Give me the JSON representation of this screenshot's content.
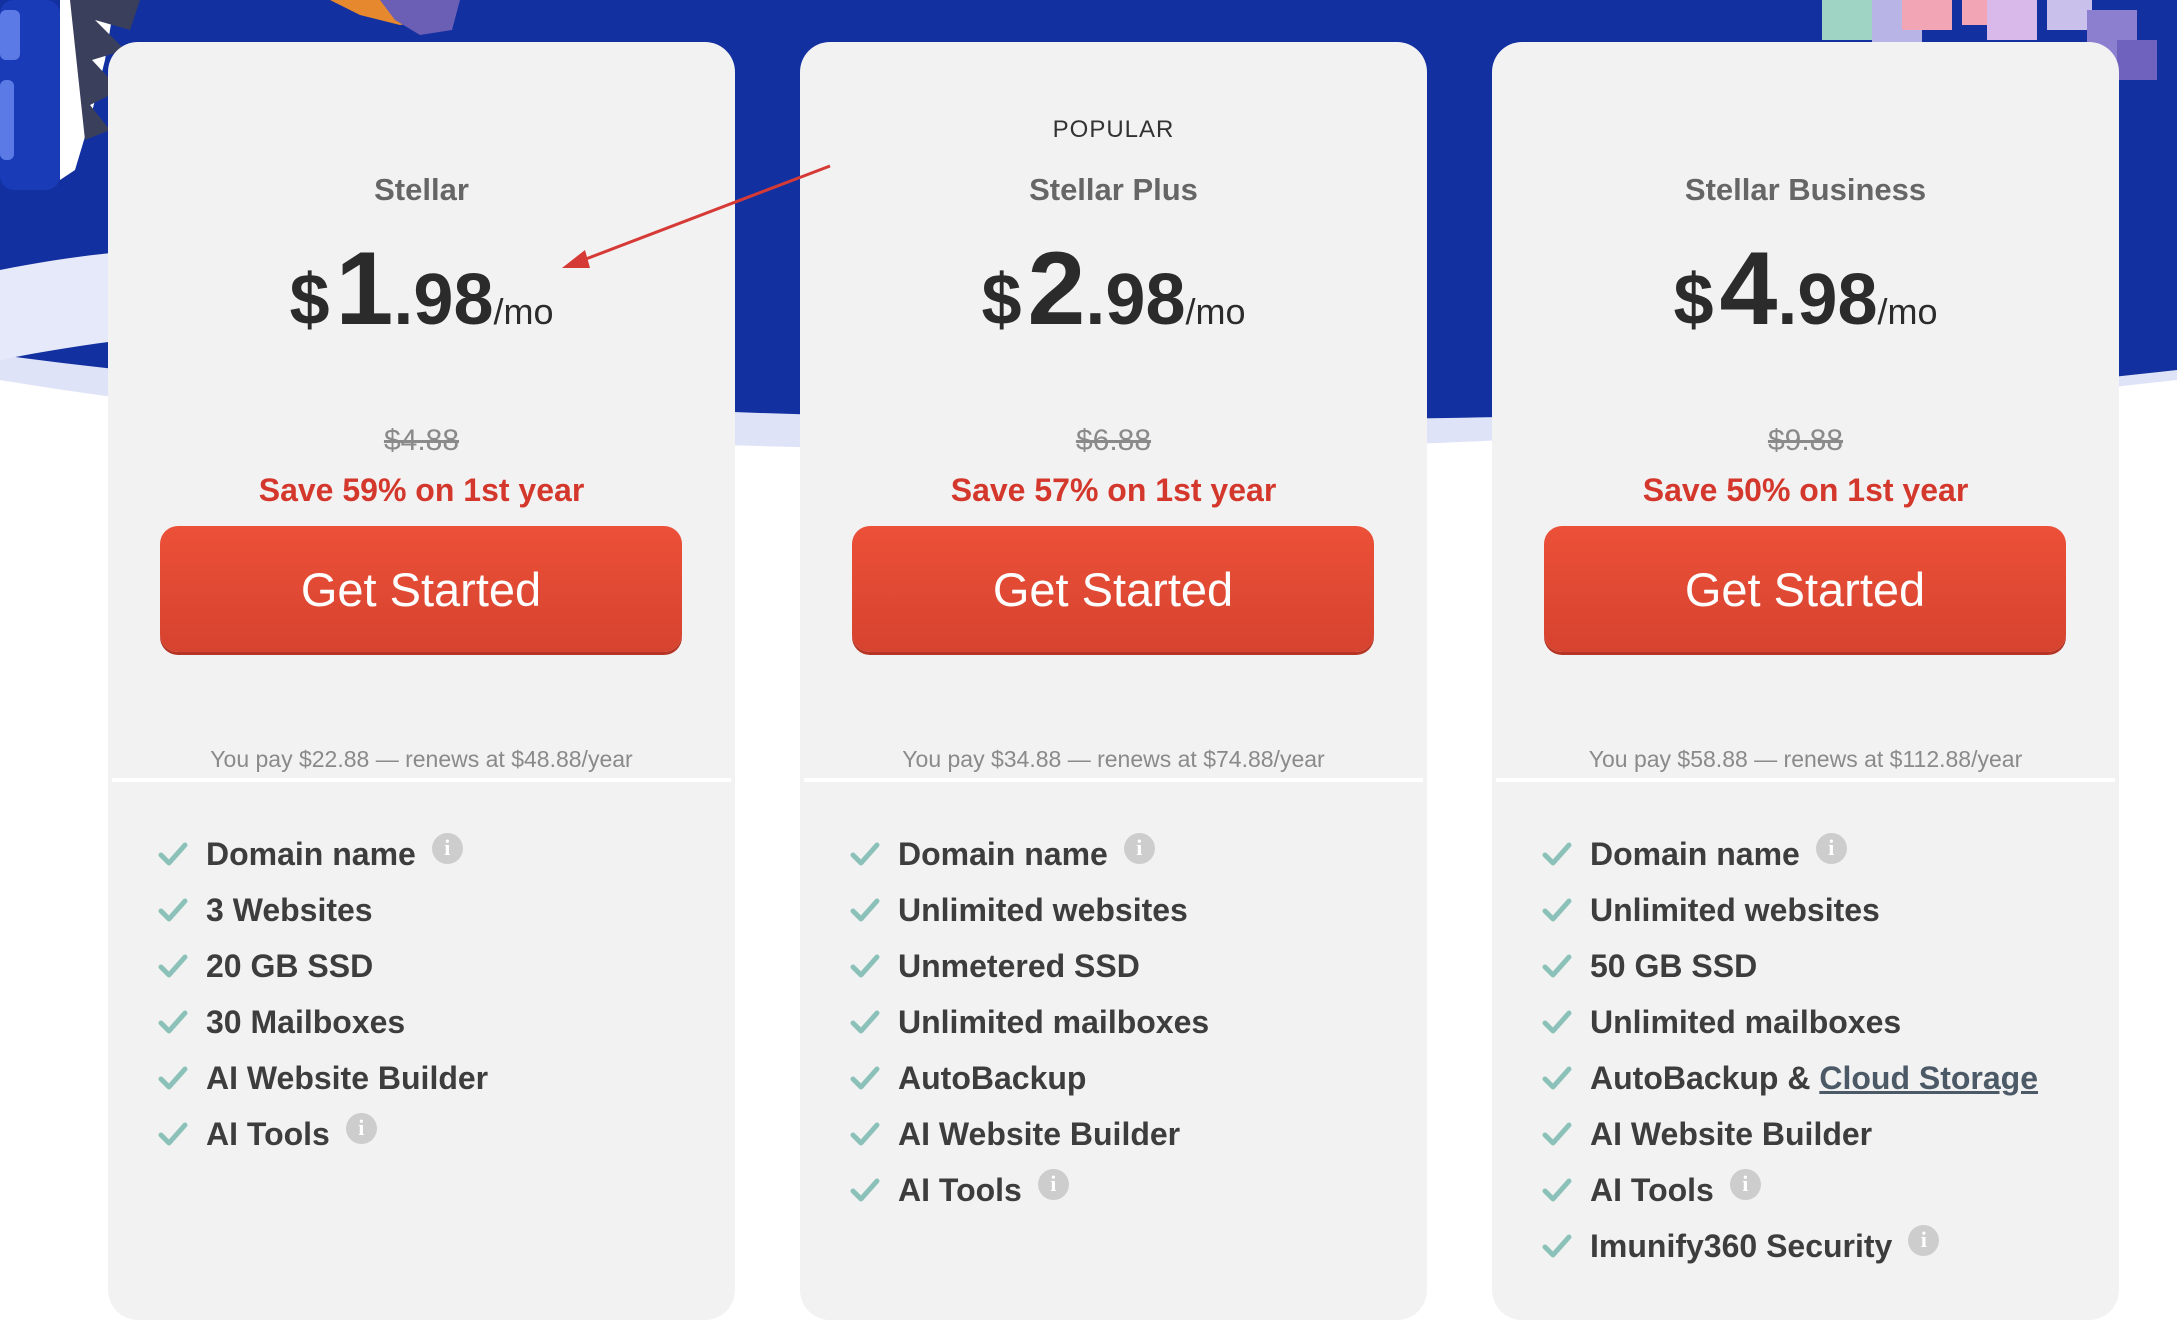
{
  "colors": {
    "hero_blue": "#1230a0",
    "accent_red": "#d4382c",
    "button": "#e54b34",
    "check_teal": "#8cc1ba",
    "annotation_arrow": "#d63a36"
  },
  "plans": [
    {
      "badge": "",
      "name": "Stellar",
      "currency": "$",
      "price_int": "1",
      "price_dec": ".98",
      "per": "/mo",
      "old_price": "$4.88",
      "save": "Save 59% on 1st year",
      "cta": "Get Started",
      "pay": "You pay $22.88 — renews at $48.88/year",
      "features": [
        {
          "label": "Domain name",
          "info": true
        },
        {
          "label": "3 Websites"
        },
        {
          "label": "20 GB SSD"
        },
        {
          "label": "30 Mailboxes"
        },
        {
          "label": "AI Website Builder"
        },
        {
          "label": "AI Tools",
          "info": true
        }
      ]
    },
    {
      "badge": "POPULAR",
      "name": "Stellar Plus",
      "currency": "$",
      "price_int": "2",
      "price_dec": ".98",
      "per": "/mo",
      "old_price": "$6.88",
      "save": "Save 57% on 1st year",
      "cta": "Get Started",
      "pay": "You pay $34.88 — renews at $74.88/year",
      "features": [
        {
          "label": "Domain name",
          "info": true
        },
        {
          "label": "Unlimited websites"
        },
        {
          "label": "Unmetered SSD"
        },
        {
          "label": "Unlimited mailboxes"
        },
        {
          "label": "AutoBackup"
        },
        {
          "label": "AI Website Builder"
        },
        {
          "label": "AI Tools",
          "info": true
        }
      ]
    },
    {
      "badge": "",
      "name": "Stellar Business",
      "currency": "$",
      "price_int": "4",
      "price_dec": ".98",
      "per": "/mo",
      "old_price": "$9.88",
      "save": "Save 50% on 1st year",
      "cta": "Get Started",
      "pay": "You pay $58.88 — renews at $112.88/year",
      "features": [
        {
          "label": "Domain name",
          "info": true
        },
        {
          "label": "Unlimited websites"
        },
        {
          "label": "50 GB SSD"
        },
        {
          "label": "Unlimited mailboxes"
        },
        {
          "label": "AutoBackup & ",
          "link": "Cloud Storage"
        },
        {
          "label": "AI Website Builder"
        },
        {
          "label": "AI Tools",
          "info": true
        },
        {
          "label": "Imunify360 Security",
          "info": true
        }
      ]
    }
  ],
  "info_glyph": "i",
  "icons": [
    "check-icon",
    "info-icon",
    "annotation-arrow"
  ]
}
